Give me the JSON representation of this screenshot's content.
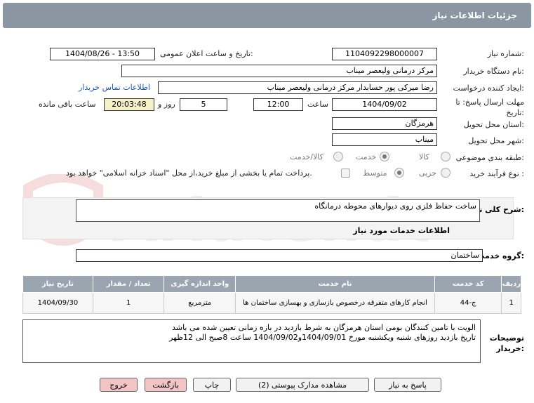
{
  "header": {
    "title": "جزئیات اطلاعات نیاز"
  },
  "form": {
    "need_number_label": "شماره نیاز:",
    "need_number": "1104092298000007",
    "announce_label": "تاریخ و ساعت اعلان عمومی:",
    "announce_value": "1404/08/26 - 13:50",
    "buyer_org_label": "نام دستگاه خریدار:",
    "buyer_org": "مرکز درمانی ولیعصر میناب",
    "creator_label": "ایجاد کننده درخواست:",
    "creator": "رضا میرکی پور حسابدار مرکز درمانی ولیعصر میناب",
    "contact_link": "اطلاعات تماس خریدار",
    "deadline_label": "مهلت ارسال پاسخ: تا تاریخ:",
    "deadline_date": "1404/09/02",
    "time_label": "ساعت",
    "deadline_time": "12:00",
    "days_value": "5",
    "days_label": "روز و",
    "remaining_time": "20:03:48",
    "remaining_label": "ساعت باقی مانده",
    "province_label": "استان محل تحویل:",
    "province": "هرمزگان",
    "city_label": "شهر محل تحویل:",
    "city": "میناب",
    "category_label": "طبقه بندی موضوعی:",
    "category_options": [
      "کالا",
      "خدمت",
      "کالا/خدمت"
    ],
    "category_selected": "خدمت",
    "process_label": "نوع فرآیند خرید :",
    "process_options": [
      "جزیی",
      "متوسط"
    ],
    "process_selected": "متوسط",
    "payment_note": "پرداخت تمام یا بخشی از مبلغ خرید،از محل \"اسناد خزانه اسلامی\" خواهد بود."
  },
  "summary": {
    "label": "شرح کلی نیاز:",
    "value": "ساخت حفاظ فلزی روی دیوارهای محوطه درمانگاه",
    "services_title": "اطلاعات خدمات مورد نیاز",
    "group_label": "گروه خدمت:",
    "group_value": "ساختمان"
  },
  "table": {
    "headers": [
      "ردیف",
      "کد خدمت",
      "نام خدمت",
      "واحد اندازه گیری",
      "تعداد / مقدار",
      "تاریخ نیاز"
    ],
    "rows": [
      [
        "1",
        "ج-44",
        "انجام کارهای متفرقه درخصوص بازسازی و بهسازی ساختمان ها",
        "مترمربع",
        "1",
        "1404/09/30"
      ]
    ]
  },
  "buyer_notes": {
    "label": "توضیحات خریدار:",
    "line1": "الویت با تامین کنندگان بومی استان هرمزگان به شرط بازدید در بازه زمانی تعیین شده می باشد",
    "line2": "تاریخ بازدید روزهای شنبه ویکشنبه مورخ 1404/09/01و1404/09/02 ساعت 8صبح الی 12ظهر"
  },
  "buttons": {
    "reply": "پاسخ به نیاز",
    "attachments": "مشاهده مدارک پیوستی (2)",
    "print": "چاپ",
    "back": "بازگشت",
    "exit": "خروج"
  },
  "watermark_text": "AriaTender.net"
}
